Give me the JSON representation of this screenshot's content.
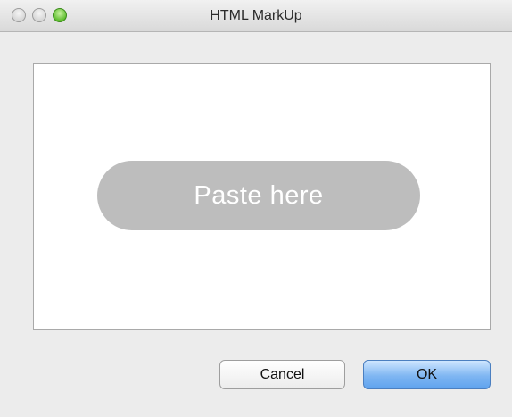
{
  "window": {
    "title": "HTML MarkUp"
  },
  "canvas": {
    "placeholder_text": "Paste here"
  },
  "buttons": {
    "cancel_label": "Cancel",
    "ok_label": "OK"
  }
}
